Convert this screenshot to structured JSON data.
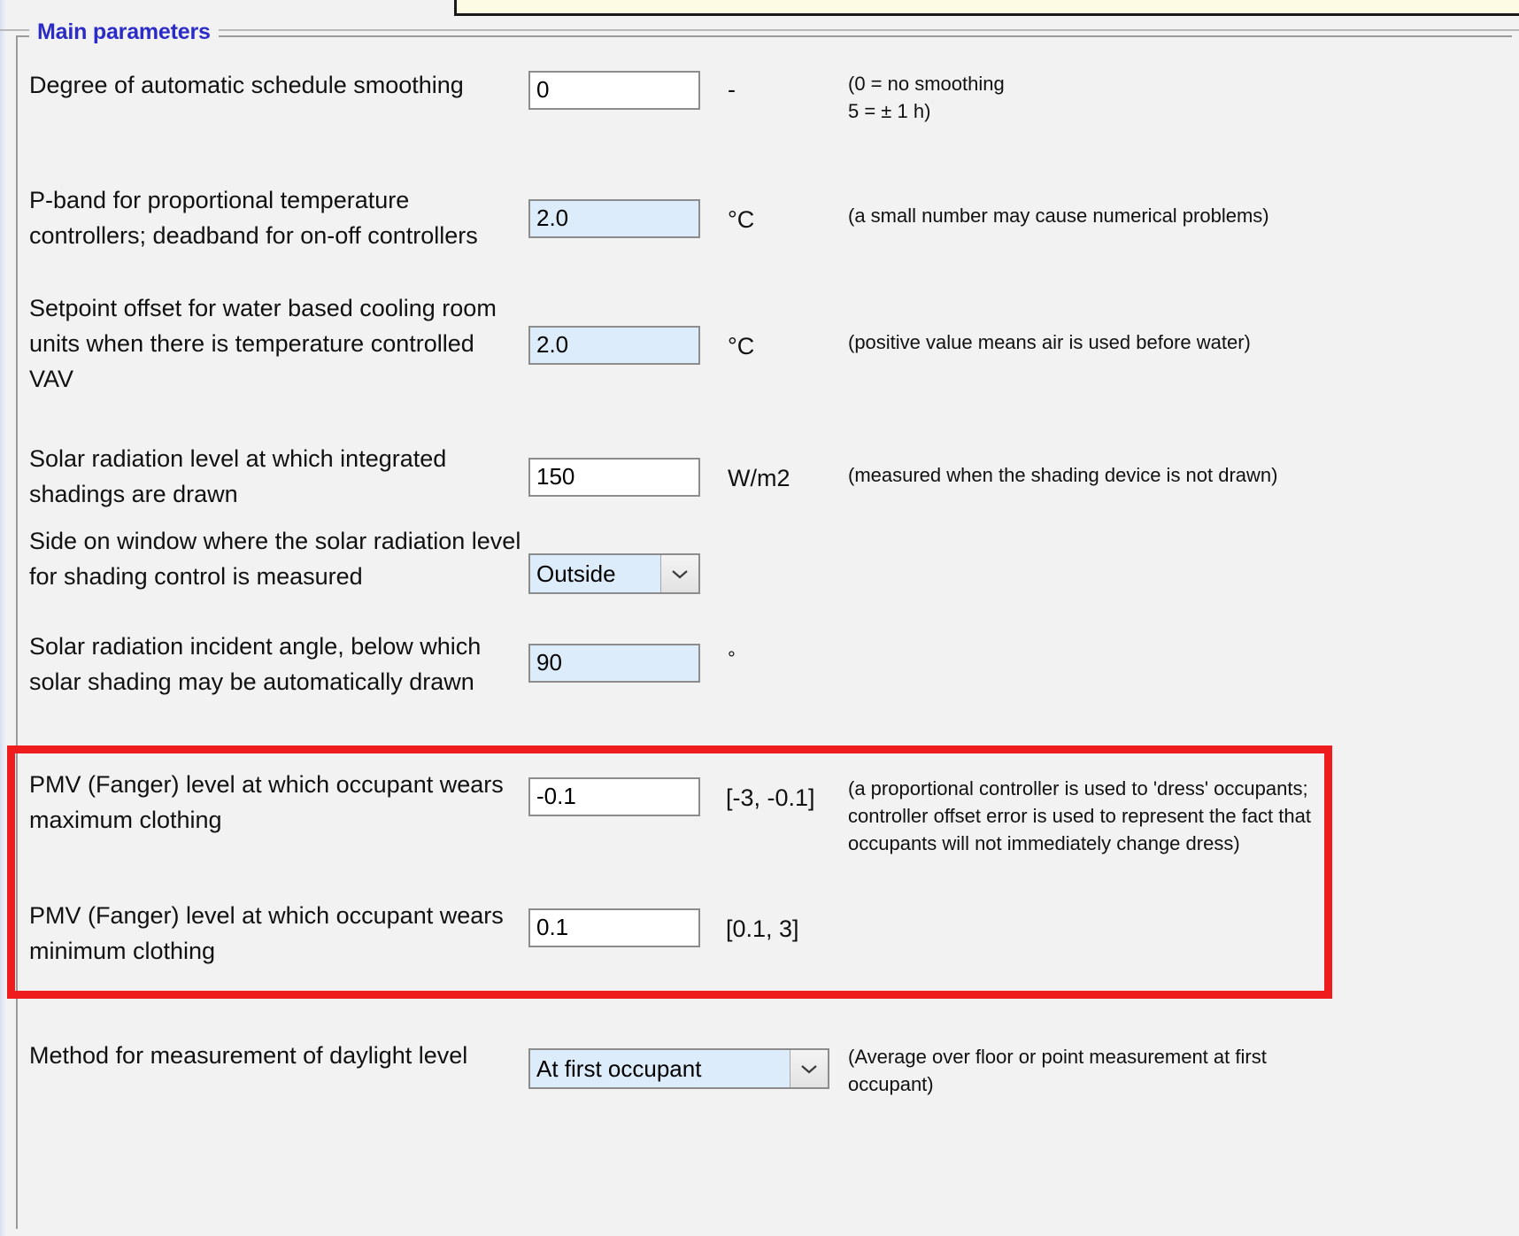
{
  "group": {
    "title": "Main parameters"
  },
  "rows": [
    {
      "id": "schedule-smoothing",
      "label": "Degree of automatic schedule smoothing",
      "value": "0",
      "unit": "-",
      "hint": "(0 = no smoothing\n5 = ± 1 h)",
      "hint_line1": "(0 = no smoothing",
      "hint_line2": "5 = ± 1 h)",
      "field_style": "white"
    },
    {
      "id": "p-band",
      "label": "P-band for proportional temperature controllers; deadband for on-off controllers",
      "value": "2.0",
      "unit": "°C",
      "hint": "(a small number may cause numerical problems)",
      "field_style": "blue"
    },
    {
      "id": "setpoint-offset-vav",
      "label": "Setpoint offset for water based cooling room units when there is temperature controlled VAV",
      "value": "2.0",
      "unit": "°C",
      "hint": "(positive value means air is used before water)",
      "field_style": "blue"
    },
    {
      "id": "solar-radiation-shading",
      "label": "Solar radiation level at which integrated shadings are drawn",
      "value": "150",
      "unit": "W/m2",
      "hint": "(measured when the shading device is not drawn)",
      "field_style": "white"
    },
    {
      "id": "window-side-measured",
      "label": "Side on window where the solar radiation level for shading control is measured",
      "value": "Outside",
      "unit": "",
      "hint": "",
      "field_style": "combo"
    },
    {
      "id": "solar-incident-angle",
      "label": "Solar radiation incident angle, below which solar shading may be automatically drawn",
      "value": "90",
      "unit": "°",
      "hint": "",
      "field_style": "blue"
    },
    {
      "id": "pmv-max-clothing",
      "label": "PMV (Fanger) level at which occupant wears maximum clothing",
      "value": "-0.1",
      "unit": "[-3, -0.1]",
      "hint": "(a proportional controller is used to 'dress' occupants; controller offset error is used to represent the fact that occupants will not immediately change dress)",
      "field_style": "white"
    },
    {
      "id": "pmv-min-clothing",
      "label": "PMV (Fanger) level at which occupant wears minimum clothing",
      "value": "0.1",
      "unit": "[0.1, 3]",
      "hint": "",
      "field_style": "white"
    },
    {
      "id": "daylight-measurement-method",
      "label": "Method for measurement of daylight level",
      "value": "At first occupant",
      "unit": "",
      "hint": "(Average over floor or point measurement at first occupant)",
      "field_style": "combo"
    }
  ],
  "icons": {
    "chevron_down": "chevron-down-icon"
  },
  "colors": {
    "highlight_box": "#ee1c1c",
    "group_title": "#2b2bc8",
    "field_blue": "#dcecfb",
    "background": "#f2f2f2"
  }
}
